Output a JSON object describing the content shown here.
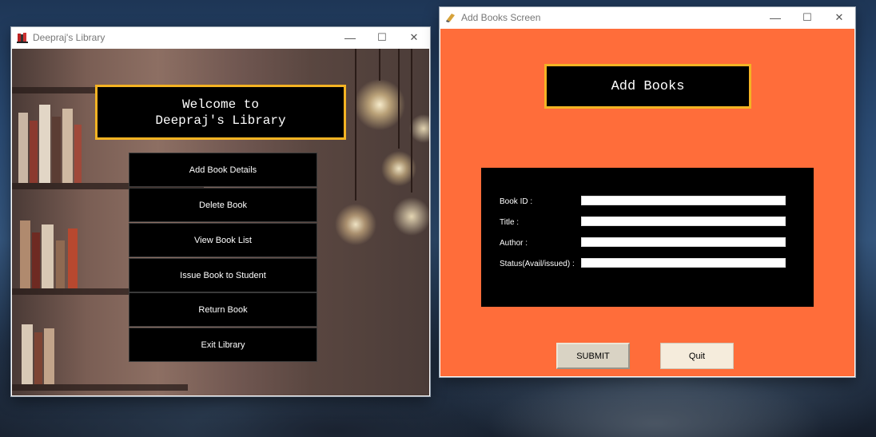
{
  "library_window": {
    "title": "Deepraj's Library",
    "welcome_text": "Welcome to\nDeepraj's Library",
    "menu_buttons": [
      "Add Book Details",
      "Delete Book",
      "View Book List",
      "Issue Book to Student",
      "Return Book",
      "Exit Library"
    ],
    "controls": {
      "minimize": "—",
      "maximize": "☐",
      "close": "✕"
    }
  },
  "add_window": {
    "title": "Add Books Screen",
    "heading": "Add Books",
    "fields": [
      {
        "label": "Book ID :",
        "value": ""
      },
      {
        "label": "Title :",
        "value": ""
      },
      {
        "label": "Author :",
        "value": ""
      },
      {
        "label": "Status(Avail/issued) :",
        "value": ""
      }
    ],
    "submit_label": "SUBMIT",
    "quit_label": "Quit",
    "controls": {
      "minimize": "—",
      "maximize": "☐",
      "close": "✕"
    }
  },
  "colors": {
    "accent_border": "#f4b323",
    "form_background": "#ff6d3a",
    "panel": "#000000"
  },
  "icons": [
    "library-app-icon",
    "add-books-app-icon",
    "minimize-icon",
    "maximize-icon",
    "close-icon"
  ]
}
